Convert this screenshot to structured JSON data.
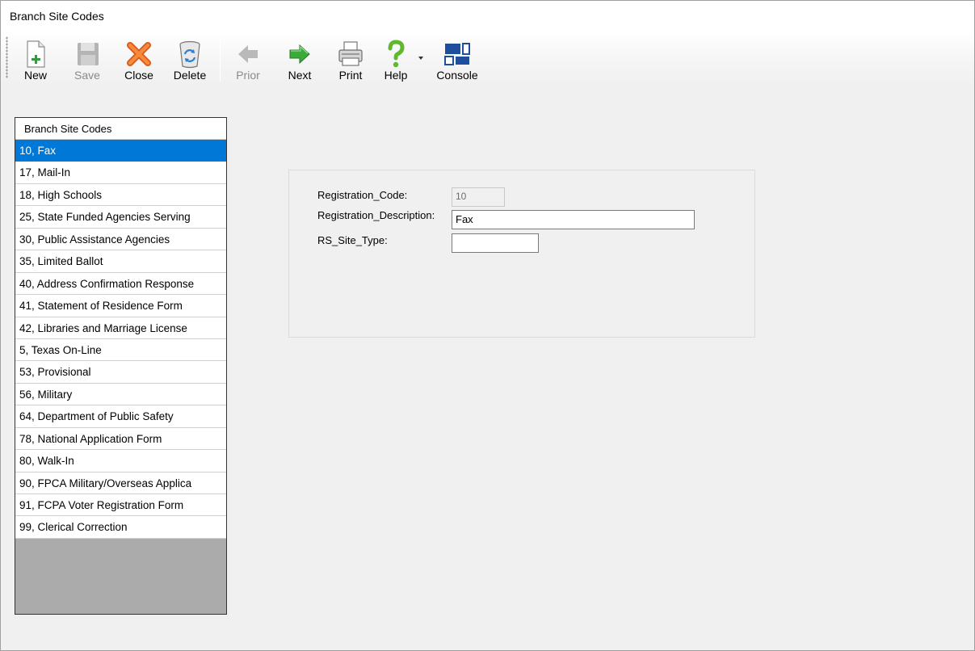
{
  "window": {
    "title": "Branch Site Codes"
  },
  "toolbar": {
    "new": "New",
    "save": "Save",
    "close": "Close",
    "delete": "Delete",
    "prior": "Prior",
    "next": "Next",
    "print": "Print",
    "help": "Help",
    "console": "Console"
  },
  "list": {
    "header": "Branch Site Codes",
    "selected_index": 0,
    "items": [
      "10, Fax",
      "17, Mail-In",
      "18, High Schools",
      "25, State Funded Agencies Serving",
      "30, Public Assistance Agencies",
      "35, Limited Ballot",
      "40, Address Confirmation Response",
      "41, Statement of Residence Form",
      "42, Libraries and Marriage License",
      "5, Texas On-Line",
      "53, Provisional",
      "56, Military",
      "64, Department of Public Safety",
      "78, National Application Form",
      "80, Walk-In",
      "90, FPCA Military/Overseas Applica",
      "91, FCPA Voter Registration Form",
      "99, Clerical Correction"
    ]
  },
  "form": {
    "code_label": "Registration_Code:",
    "code_value": "10",
    "desc_label": "Registration_Description:",
    "desc_value": "Fax",
    "site_type_label": "RS_Site_Type:",
    "site_type_value": ""
  },
  "colors": {
    "selection": "#0078d7",
    "list_empty_area": "#ababab",
    "window_bg": "#f0f0f0"
  }
}
